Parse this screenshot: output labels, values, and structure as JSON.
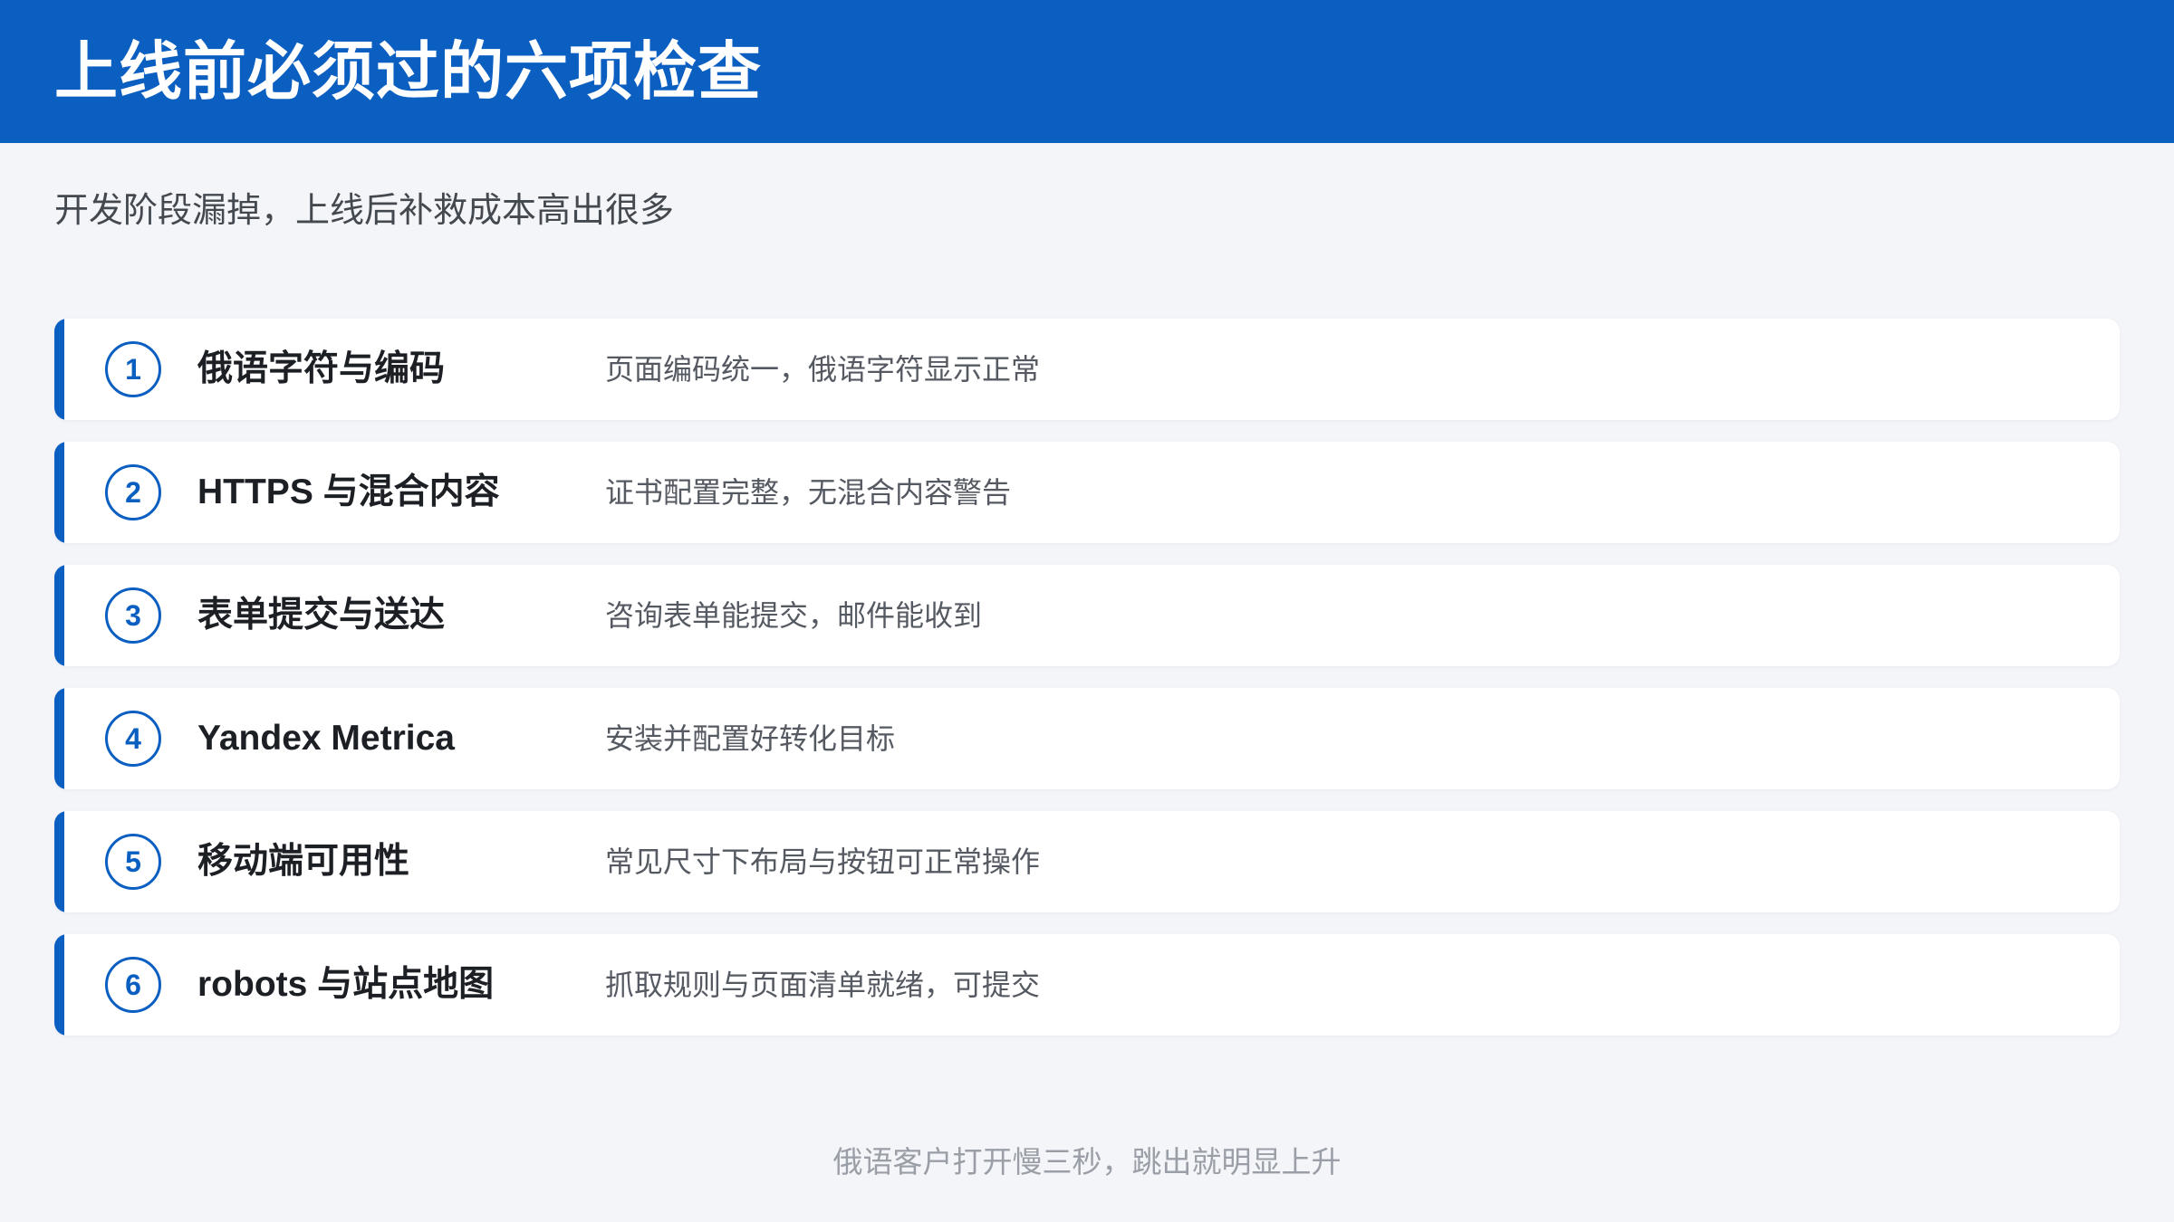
{
  "header": {
    "title": "上线前必须过的六项检查",
    "color": "#0b5fc1"
  },
  "subtitle": "开发阶段漏掉，上线后补救成本高出很多",
  "checks": [
    {
      "number": "1",
      "title": "俄语字符与编码",
      "description": "页面编码统一，俄语字符显示正常"
    },
    {
      "number": "2",
      "title": "HTTPS 与混合内容",
      "description": "证书配置完整，无混合内容警告"
    },
    {
      "number": "3",
      "title": "表单提交与送达",
      "description": "咨询表单能提交，邮件能收到"
    },
    {
      "number": "4",
      "title": "Yandex Metrica",
      "description": "安装并配置好转化目标"
    },
    {
      "number": "5",
      "title": "移动端可用性",
      "description": "常见尺寸下布局与按钮可正常操作"
    },
    {
      "number": "6",
      "title": "robots 与站点地图",
      "description": "抓取规则与页面清单就绪，可提交"
    }
  ],
  "footer": "俄语客户打开慢三秒，跳出就明显上升"
}
